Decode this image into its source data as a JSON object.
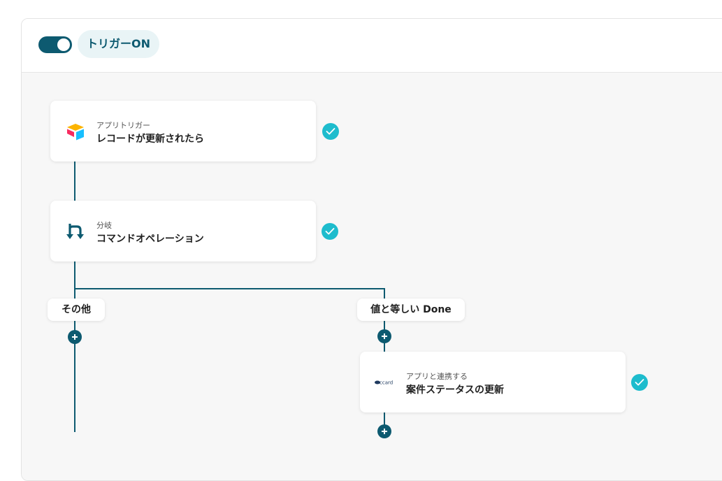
{
  "header": {
    "trigger_status": "トリガーON",
    "toggle_on": true
  },
  "flow": {
    "steps": [
      {
        "sub": "アプリトリガー",
        "title": "レコードが更新されたら",
        "icon": "airtable-logo-icon",
        "completed": true
      },
      {
        "sub": "分岐",
        "title": "コマンドオペレーション",
        "icon": "branch-icon",
        "completed": true
      },
      {
        "sub": "アプリと連携する",
        "title": "案件ステータスの更新",
        "icon": "ccard-logo-icon",
        "completed": true
      }
    ],
    "branches": [
      {
        "label": "その他"
      },
      {
        "label": "値と等しい Done"
      }
    ]
  },
  "colors": {
    "accent": "#0d5a70",
    "check": "#1ebccd",
    "pill_bg": "#e9f4f6"
  }
}
